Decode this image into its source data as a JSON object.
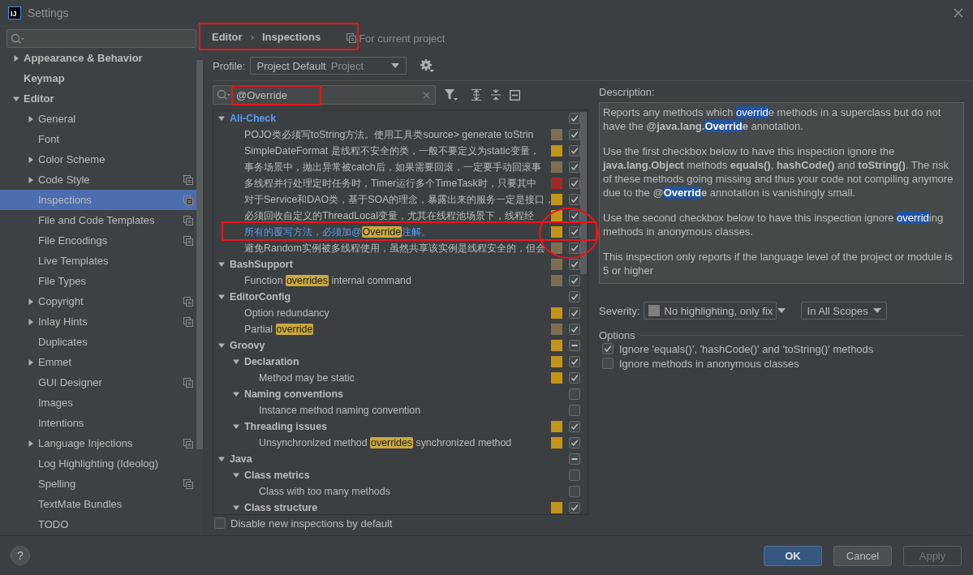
{
  "window": {
    "logo": "IJ",
    "title": "Settings"
  },
  "sidebar": {
    "items": [
      {
        "label": "Appearance & Behavior",
        "expanded": false,
        "selected": false,
        "project_scope": false
      },
      {
        "label": "Keymap",
        "selected": false,
        "project_scope": false
      },
      {
        "label": "Editor",
        "expanded": true,
        "selected": false,
        "project_scope": false,
        "children": [
          {
            "label": "General",
            "expanded": false,
            "selected": false,
            "project_scope": false
          },
          {
            "label": "Font",
            "selected": false,
            "project_scope": false
          },
          {
            "label": "Color Scheme",
            "expanded": false,
            "selected": false,
            "project_scope": false
          },
          {
            "label": "Code Style",
            "expanded": false,
            "selected": false,
            "project_scope": true
          },
          {
            "label": "Inspections",
            "selected": true,
            "project_scope": true
          },
          {
            "label": "File and Code Templates",
            "selected": false,
            "project_scope": true
          },
          {
            "label": "File Encodings",
            "selected": false,
            "project_scope": true
          },
          {
            "label": "Live Templates",
            "selected": false,
            "project_scope": false
          },
          {
            "label": "File Types",
            "selected": false,
            "project_scope": false
          },
          {
            "label": "Copyright",
            "expanded": false,
            "selected": false,
            "project_scope": true
          },
          {
            "label": "Inlay Hints",
            "expanded": false,
            "selected": false,
            "project_scope": true
          },
          {
            "label": "Duplicates",
            "selected": false,
            "project_scope": false
          },
          {
            "label": "Emmet",
            "expanded": false,
            "selected": false,
            "project_scope": false
          },
          {
            "label": "GUI Designer",
            "selected": false,
            "project_scope": true
          },
          {
            "label": "Images",
            "selected": false,
            "project_scope": false
          },
          {
            "label": "Intentions",
            "selected": false,
            "project_scope": false
          },
          {
            "label": "Language Injections",
            "expanded": false,
            "selected": false,
            "project_scope": true
          },
          {
            "label": "Log Highlighting (Ideolog)",
            "selected": false,
            "project_scope": false
          },
          {
            "label": "Spelling",
            "selected": false,
            "project_scope": true
          },
          {
            "label": "TextMate Bundles",
            "selected": false,
            "project_scope": false
          },
          {
            "label": "TODO",
            "selected": false,
            "project_scope": false
          }
        ]
      }
    ]
  },
  "breadcrumb": [
    "Editor",
    "Inspections"
  ],
  "breadcrumb_separator": "›",
  "scope_note": "For current project",
  "profile": {
    "label": "Profile:",
    "value": "Project Default",
    "scope": "Project"
  },
  "filter": {
    "value": "@Override"
  },
  "tree": [
    {
      "kind": "group",
      "expanded": true,
      "modified": true,
      "checked": true,
      "mixed": false,
      "label": [
        {
          "text": "Ali-Check",
          "highlighted": false
        }
      ],
      "children": [
        {
          "kind": "inspection",
          "modified": false,
          "color": "#7a6f55",
          "checked": true,
          "mixed": false,
          "label": [
            {
              "text": "POJO类必须写toString方法。使用工具类source> generate toStrin",
              "highlighted": false
            }
          ]
        },
        {
          "kind": "inspection",
          "modified": false,
          "color": "#c49419",
          "checked": true,
          "mixed": false,
          "label": [
            {
              "text": "SimpleDateFormat 是线程不安全的类，一般不要定义为static变量，",
              "highlighted": false
            }
          ]
        },
        {
          "kind": "inspection",
          "modified": false,
          "color": "#7a6f55",
          "checked": true,
          "mixed": false,
          "label": [
            {
              "text": "事务场景中，抛出异常被catch后，如果需要回滚，一定要手动回滚事",
              "highlighted": false
            }
          ]
        },
        {
          "kind": "inspection",
          "modified": false,
          "color": "#a12a26",
          "checked": true,
          "mixed": false,
          "label": [
            {
              "text": "多线程并行处理定时任务时，Timer运行多个TimeTask时，只要其中",
              "highlighted": false
            }
          ]
        },
        {
          "kind": "inspection",
          "modified": false,
          "color": "#c49419",
          "checked": true,
          "mixed": false,
          "label": [
            {
              "text": "对于Service和DAO类，基于SOA的理念，暴露出来的服务一定是接口，",
              "highlighted": false
            }
          ]
        },
        {
          "kind": "inspection",
          "modified": false,
          "color": "#c49419",
          "checked": true,
          "mixed": false,
          "label": [
            {
              "text": "必须回收自定义的ThreadLocal变量，尤其在线程池场景下，线程经",
              "highlighted": false
            }
          ]
        },
        {
          "kind": "inspection",
          "modified": true,
          "color": "#c49419",
          "checked": true,
          "mixed": false,
          "label": [
            {
              "text": "所有的覆写方法，必须加@",
              "highlighted": false
            },
            {
              "text": "Override",
              "highlighted": true
            },
            {
              "text": "注解。",
              "highlighted": false
            }
          ]
        },
        {
          "kind": "inspection",
          "modified": false,
          "color": "#7a6f55",
          "checked": true,
          "mixed": false,
          "label": [
            {
              "text": "避免Random实例被多线程使用，虽然共享该实例是线程安全的，但会",
              "highlighted": false
            }
          ]
        }
      ]
    },
    {
      "kind": "group",
      "expanded": true,
      "modified": false,
      "color": "#7a6f55",
      "checked": true,
      "mixed": false,
      "label": [
        {
          "text": "BashSupport",
          "highlighted": false
        }
      ],
      "children": [
        {
          "kind": "inspection",
          "modified": false,
          "color": "#7a6f55",
          "checked": true,
          "mixed": false,
          "label": [
            {
              "text": "Function ",
              "highlighted": false
            },
            {
              "text": "overrides",
              "highlighted": true
            },
            {
              "text": " internal command",
              "highlighted": false
            }
          ]
        }
      ]
    },
    {
      "kind": "group",
      "expanded": true,
      "modified": false,
      "checked": true,
      "mixed": false,
      "label": [
        {
          "text": "EditorConfig",
          "highlighted": false
        }
      ],
      "children": [
        {
          "kind": "inspection",
          "modified": false,
          "color": "#c49419",
          "checked": true,
          "mixed": false,
          "label": [
            {
              "text": "Option redundancy",
              "highlighted": false
            }
          ]
        },
        {
          "kind": "inspection",
          "modified": false,
          "color": "#7a6f55",
          "checked": true,
          "mixed": false,
          "label": [
            {
              "text": "Partial ",
              "highlighted": false
            },
            {
              "text": "override",
              "highlighted": true
            }
          ]
        }
      ]
    },
    {
      "kind": "group",
      "expanded": true,
      "modified": false,
      "color": "#c49419",
      "mixed": true,
      "label": [
        {
          "text": "Groovy",
          "highlighted": false
        }
      ],
      "children": [
        {
          "kind": "group",
          "expanded": true,
          "modified": false,
          "color": "#c49419",
          "checked": true,
          "mixed": false,
          "label": [
            {
              "text": "Declaration",
              "highlighted": false
            }
          ],
          "children": [
            {
              "kind": "inspection",
              "modified": false,
              "color": "#c49419",
              "checked": true,
              "mixed": false,
              "label": [
                {
                  "text": "Method may be static",
                  "highlighted": false
                }
              ]
            }
          ]
        },
        {
          "kind": "group",
          "expanded": true,
          "modified": false,
          "checked": false,
          "mixed": false,
          "label": [
            {
              "text": "Naming conventions",
              "highlighted": false
            }
          ],
          "children": [
            {
              "kind": "inspection",
              "modified": false,
              "checked": false,
              "mixed": false,
              "label": [
                {
                  "text": "Instance method naming convention",
                  "highlighted": false
                }
              ]
            }
          ]
        },
        {
          "kind": "group",
          "expanded": true,
          "modified": false,
          "color": "#c49419",
          "checked": true,
          "mixed": false,
          "label": [
            {
              "text": "Threading issues",
              "highlighted": false
            }
          ],
          "children": [
            {
              "kind": "inspection",
              "modified": false,
              "color": "#c49419",
              "checked": true,
              "mixed": false,
              "label": [
                {
                  "text": "Unsynchronized method ",
                  "highlighted": false
                },
                {
                  "text": "overrides",
                  "highlighted": true
                },
                {
                  "text": " synchronized method",
                  "highlighted": false
                }
              ]
            }
          ]
        }
      ]
    },
    {
      "kind": "group",
      "expanded": true,
      "modified": false,
      "mixed": true,
      "label": [
        {
          "text": "Java",
          "highlighted": false
        }
      ],
      "children": [
        {
          "kind": "group",
          "expanded": true,
          "modified": false,
          "checked": false,
          "mixed": false,
          "label": [
            {
              "text": "Class metrics",
              "highlighted": false
            }
          ],
          "children": [
            {
              "kind": "inspection",
              "modified": false,
              "checked": false,
              "mixed": false,
              "label": [
                {
                  "text": "Class with too many methods",
                  "highlighted": false
                }
              ]
            }
          ]
        },
        {
          "kind": "group",
          "expanded": true,
          "modified": false,
          "color": "#c49419",
          "checked": true,
          "mixed": false,
          "label": [
            {
              "text": "Class structure",
              "highlighted": false
            }
          ]
        }
      ]
    }
  ],
  "disable_new": {
    "label": "Disable new inspections by default",
    "checked": false
  },
  "description": {
    "label": "Description:",
    "paragraphs": [
      [
        {
          "text": "Reports any methods which ",
          "highlighted": false
        },
        {
          "text": "overrid",
          "highlighted": true
        },
        {
          "text": "e methods in a superclass but do not have the **@java.lang.**",
          "highlighted": false
        },
        {
          "text": "**Overrid**",
          "highlighted": true
        },
        {
          "text": "**e** annotation.",
          "highlighted": false
        }
      ],
      [
        {
          "text": "Use the first checkbox below to have this inspection ignore the **java.lang.Object** methods **equals()**, **hashCode()** and **toString()**. The risk of these methods going missing and thus your code not compiling anymore due to the @",
          "highlighted": false
        },
        {
          "text": "**Overrid**",
          "highlighted": true
        },
        {
          "text": "**e** annotation is vanishingly small.",
          "highlighted": false
        }
      ],
      [
        {
          "text": "Use the second checkbox below to have this inspection ignore ",
          "highlighted": false
        },
        {
          "text": "overrid",
          "highlighted": true
        },
        {
          "text": "ing methods in anonymous classes.",
          "highlighted": false
        }
      ],
      [
        {
          "text": "This inspection only reports if the language level of the project or module is 5 or higher",
          "highlighted": false
        }
      ]
    ]
  },
  "severity": {
    "label": "Severity:",
    "value": "No highlighting, only fix",
    "scope": "In All Scopes"
  },
  "options": {
    "label": "Options",
    "items": [
      {
        "label": "Ignore 'equals()', 'hashCode()' and 'toString()' methods",
        "checked": true
      },
      {
        "label": "Ignore methods in anonymous classes",
        "checked": false
      }
    ]
  },
  "footer": {
    "help": "?",
    "buttons": [
      {
        "label": "OK",
        "kind": "primary"
      },
      {
        "label": "Cancel",
        "kind": "normal"
      },
      {
        "label": "Apply",
        "kind": "disabled"
      }
    ]
  }
}
